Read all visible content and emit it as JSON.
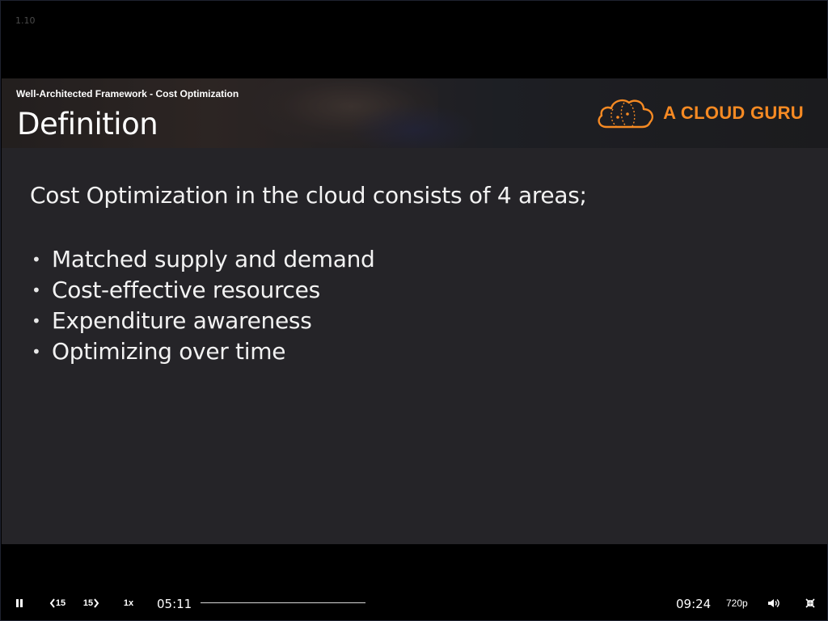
{
  "player": {
    "version_label": "1.10"
  },
  "slide": {
    "section_label": "Well-Architected Framework - Cost Optimization",
    "title": "Definition",
    "brand": {
      "name": "A CLOUD GURU",
      "icon": "cloud-logo-icon",
      "color": "#f68a23"
    },
    "intro": "Cost Optimization in the cloud consists of 4 areas;",
    "bullets": [
      "Matched supply and demand",
      "Cost-effective resources",
      "Expenditure awareness",
      "Optimizing over time"
    ]
  },
  "controls": {
    "play_state_icon": "pause-icon",
    "rewind_label": "15",
    "forward_label": "15",
    "speed_label": "1x",
    "current_time": "05:11",
    "duration": "09:24",
    "quality_label": "720p",
    "volume_icon": "volume-icon",
    "exit_fullscreen_icon": "exit-fullscreen-icon"
  }
}
